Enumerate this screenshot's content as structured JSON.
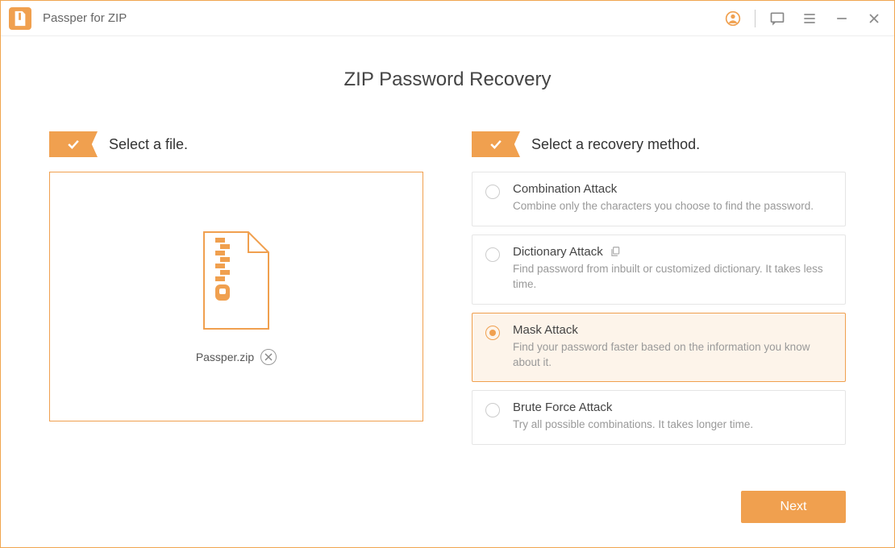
{
  "app": {
    "title": "Passper for ZIP"
  },
  "pageTitle": "ZIP Password Recovery",
  "step1": {
    "label": "Select a file."
  },
  "step2": {
    "label": "Select a recovery method."
  },
  "selectedFile": {
    "name": "Passper.zip"
  },
  "methods": {
    "combination": {
      "title": "Combination Attack",
      "desc": "Combine only the characters you choose to find the password."
    },
    "dictionary": {
      "title": "Dictionary Attack",
      "desc": "Find password from inbuilt or customized dictionary. It takes less time."
    },
    "mask": {
      "title": "Mask Attack",
      "desc": "Find your password faster based on the information you know about it."
    },
    "brute": {
      "title": "Brute Force Attack",
      "desc": "Try all possible combinations. It takes longer time."
    }
  },
  "footer": {
    "next": "Next"
  }
}
